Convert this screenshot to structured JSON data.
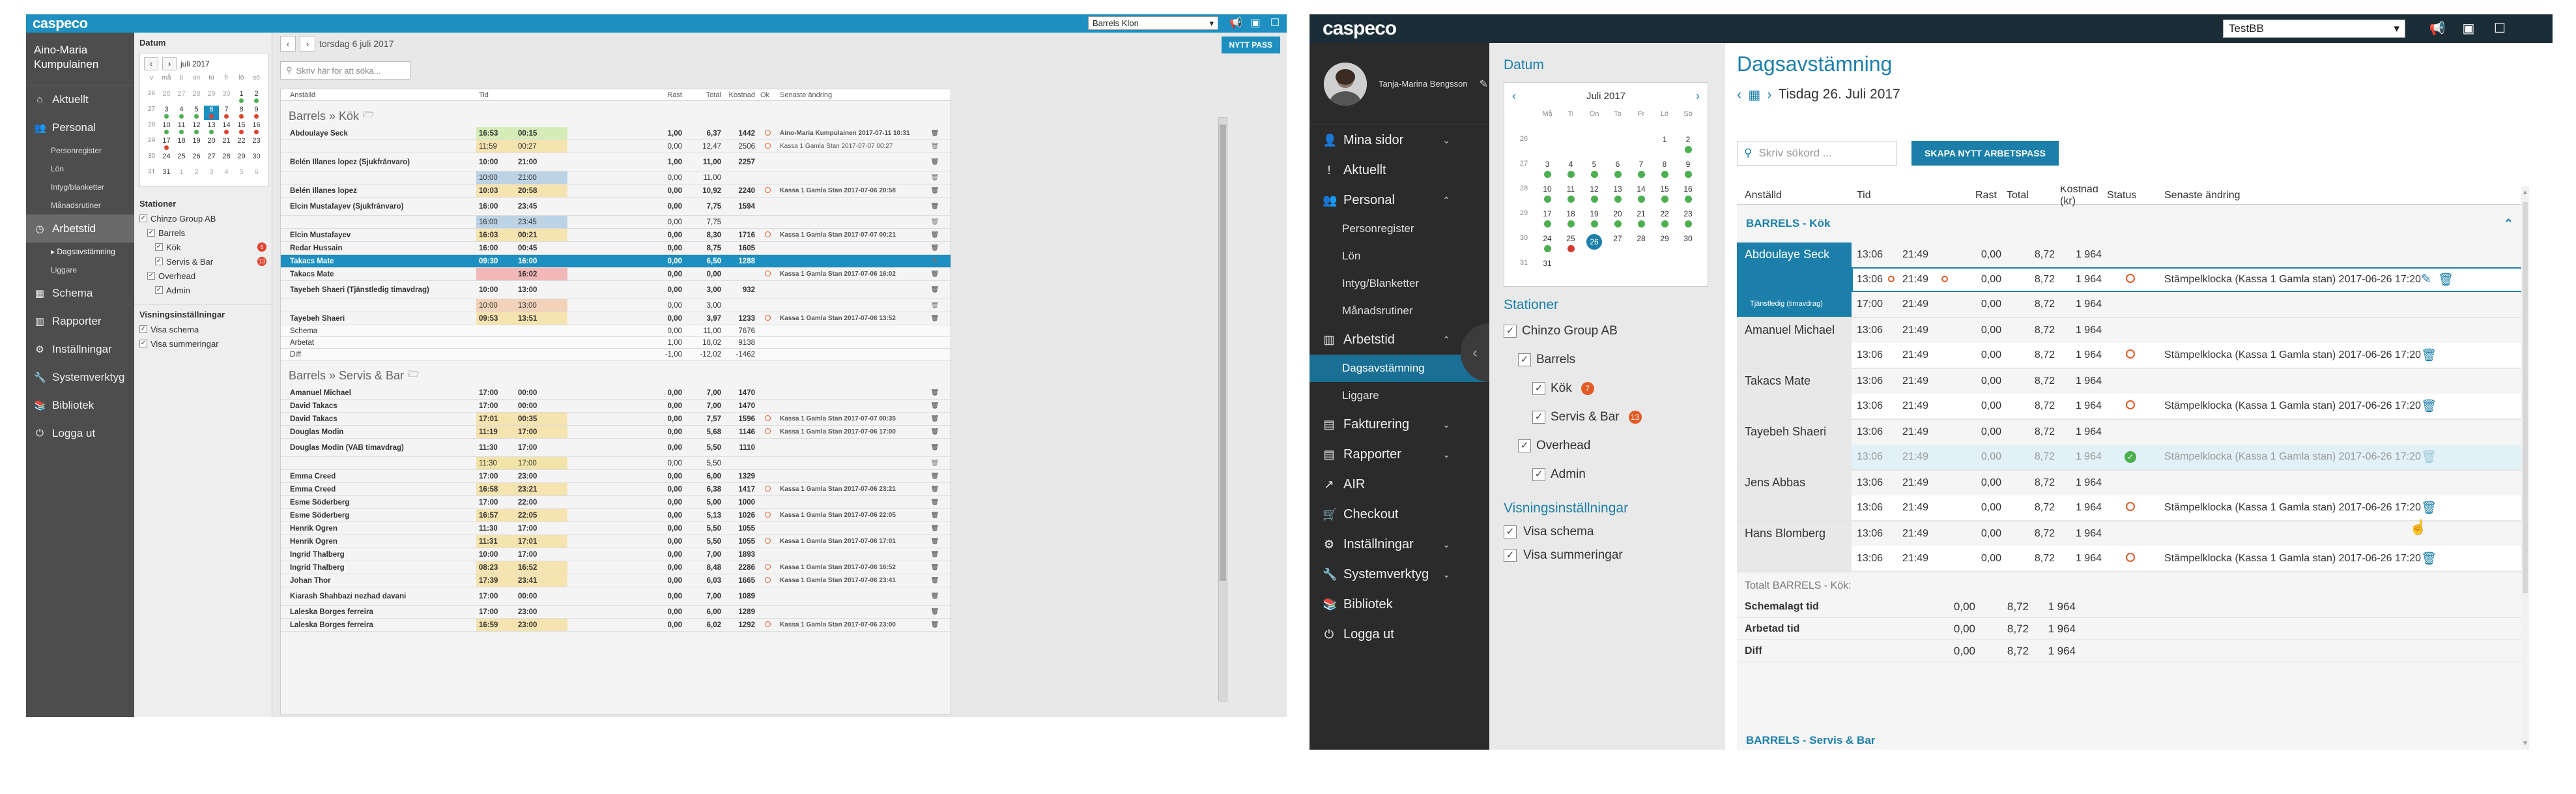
{
  "a": {
    "logo": "caspeco",
    "org_select": "Barrels Klon",
    "user_name": "Aino-Maria Kumpulainen",
    "nav": [
      {
        "label": "Aktuellt",
        "icon": "home-icon"
      },
      {
        "label": "Personal",
        "icon": "people-icon"
      },
      {
        "label": "Arbetstid",
        "icon": "clock-icon",
        "active": true
      },
      {
        "label": "Schema",
        "icon": "calendar-icon"
      },
      {
        "label": "Rapporter",
        "icon": "chart-icon"
      },
      {
        "label": "Inställningar",
        "icon": "gear-icon"
      },
      {
        "label": "Systemverktyg",
        "icon": "wrench-icon"
      },
      {
        "label": "Bibliotek",
        "icon": "book-icon"
      },
      {
        "label": "Logga ut",
        "icon": "power-icon"
      }
    ],
    "personal_subs": [
      "Personregister",
      "Lön",
      "Intyg/blanketter",
      "Månadsrutiner"
    ],
    "arbetstid_subs": [
      "Dagsavstämning",
      "Liggare"
    ],
    "datum_label": "Datum",
    "month_label": "juli 2017",
    "weekdays": [
      "v",
      "må",
      "ti",
      "on",
      "to",
      "fr",
      "lö",
      "sö"
    ],
    "calendar_rows": [
      [
        "26",
        "26",
        "27",
        "28",
        "29",
        "30",
        "1",
        "2"
      ],
      [
        "27",
        "3",
        "4",
        "5",
        "6",
        "7",
        "8",
        "9"
      ],
      [
        "28",
        "10",
        "11",
        "12",
        "13",
        "14",
        "15",
        "16"
      ],
      [
        "29",
        "17",
        "18",
        "19",
        "20",
        "21",
        "22",
        "23"
      ],
      [
        "30",
        "24",
        "25",
        "26",
        "27",
        "28",
        "29",
        "30"
      ],
      [
        "31",
        "31",
        "1",
        "2",
        "3",
        "4",
        "5",
        "6"
      ]
    ],
    "stationer_label": "Stationer",
    "tree": [
      {
        "label": "Chinzo Group AB",
        "indent": 0
      },
      {
        "label": "Barrels",
        "indent": 1
      },
      {
        "label": "Kök",
        "indent": 2,
        "badge": "6",
        "badge_color": "#e0412f"
      },
      {
        "label": "Servis & Bar",
        "indent": 2,
        "badge": "13",
        "badge_color": "#e0412f"
      },
      {
        "label": "Overhead",
        "indent": 1
      },
      {
        "label": "Admin",
        "indent": 2
      }
    ],
    "vis_label": "Visningsinställningar",
    "vis": [
      "Visa schema",
      "Visa summeringar"
    ],
    "date_text": "torsdag 6 juli 2017",
    "new_button": "NYTT PASS",
    "search_placeholder": "Skriv här för att söka...",
    "headers": [
      "Anställd",
      "Tid",
      "Rast",
      "Total",
      "Kostnad",
      "Ok",
      "Senaste ändring"
    ],
    "group1": "Barrels » Kök",
    "group2": "Barrels » Servis & Bar",
    "rows1": [
      {
        "name": "Abdoulaye Seck",
        "in": "16:53",
        "out": "00:15",
        "rast": "1,00",
        "tot": "6,37",
        "cost": "1442",
        "ok": "o",
        "chg": "Aino-Maria Kumpulainen 2017-07-11 10:31",
        "bg": "#d6ecb8"
      },
      {
        "name": "",
        "in": "11:59",
        "out": "00:27",
        "rast": "0,00",
        "tot": "12,47",
        "cost": "2506",
        "ok": "o",
        "chg": "Kassa 1 Gamla Stan 2017-07-07 00:27",
        "bg": "#f5e3b0"
      },
      {
        "name": "Belén Illanes lopez (Sjukfrånvaro)",
        "in": "10:00",
        "out": "21:00",
        "rast": "1,00",
        "tot": "11,00",
        "cost": "2257",
        "ok": "",
        "chg": "",
        "bg": "#f4f4f4"
      },
      {
        "name": "",
        "in": "10:00",
        "out": "21:00",
        "rast": "0,00",
        "tot": "11,00",
        "cost": "",
        "ok": "",
        "chg": "",
        "bg": "#bcd3e6"
      },
      {
        "name": "Belén Illanes lopez",
        "in": "10:03",
        "out": "20:58",
        "rast": "0,00",
        "tot": "10,92",
        "cost": "2240",
        "ok": "o",
        "chg": "Kassa 1 Gamla Stan 2017-07-06 20:58",
        "bg": "#f5e3b0"
      },
      {
        "name": "Elcin Mustafayev (Sjukfrånvaro)",
        "in": "16:00",
        "out": "23:45",
        "rast": "0,00",
        "tot": "7,75",
        "cost": "1594",
        "ok": "",
        "chg": "",
        "bg": "#f4f4f4"
      },
      {
        "name": "",
        "in": "16:00",
        "out": "23:45",
        "rast": "0,00",
        "tot": "7,75",
        "cost": "",
        "ok": "",
        "chg": "",
        "bg": "#bcd3e6"
      },
      {
        "name": "Elcin Mustafayev",
        "in": "16:03",
        "out": "00:21",
        "rast": "0,00",
        "tot": "8,30",
        "cost": "1716",
        "ok": "o",
        "chg": "Kassa 1 Gamla Stan 2017-07-07 00:21",
        "bg": "#f5e3b0"
      },
      {
        "name": "Redar Hussain",
        "in": "16:00",
        "out": "00:45",
        "rast": "0,00",
        "tot": "8,75",
        "cost": "1605",
        "ok": "",
        "chg": "",
        "bg": "#f4f4f4"
      },
      {
        "name": "Takacs Mate",
        "in": "09:30",
        "out": "16:00",
        "rast": "0,00",
        "tot": "6,50",
        "cost": "1288",
        "ok": "",
        "chg": "",
        "bg": "#1d8fc0",
        "sel": true
      },
      {
        "name": "Takacs Mate",
        "in": "",
        "out": "16:02",
        "rast": "0,00",
        "tot": "0,00",
        "cost": "",
        "ok": "o",
        "chg": "Kassa 1 Gamla Stan 2017-07-06 16:02",
        "bg": "#f2b8b8"
      },
      {
        "name": "Tayebeh Shaeri (Tjänstledig timavdrag)",
        "in": "10:00",
        "out": "13:00",
        "rast": "0,00",
        "tot": "3,00",
        "cost": "932",
        "ok": "",
        "chg": "",
        "bg": "#f4f4f4"
      },
      {
        "name": "",
        "in": "10:00",
        "out": "13:00",
        "rast": "0,00",
        "tot": "3,00",
        "cost": "",
        "ok": "",
        "chg": "",
        "bg": "#f2d2b8"
      },
      {
        "name": "Tayebeh Shaeri",
        "in": "09:53",
        "out": "13:51",
        "rast": "0,00",
        "tot": "3,97",
        "cost": "1233",
        "ok": "o",
        "chg": "Kassa 1 Gamla Stan 2017-07-06 13:52",
        "bg": "#f5e3b0"
      }
    ],
    "summary1": [
      {
        "label": "Schema",
        "rast": "0,00",
        "tot": "11,00",
        "cost": "7676"
      },
      {
        "label": "Arbetat",
        "rast": "1,00",
        "tot": "18,02",
        "cost": "9138"
      },
      {
        "label": "Diff",
        "rast": "-1,00",
        "tot": "-12,02",
        "cost": "-1462"
      }
    ],
    "rows2": [
      {
        "name": "Amanuel Michael",
        "in": "17:00",
        "out": "00:00",
        "rast": "0,00",
        "tot": "7,00",
        "cost": "1470",
        "ok": "",
        "chg": "",
        "bg": "#f4f4f4"
      },
      {
        "name": "David Takacs",
        "in": "17:00",
        "out": "00:00",
        "rast": "0,00",
        "tot": "7,00",
        "cost": "1470",
        "ok": "",
        "chg": "",
        "bg": "#f4f4f4"
      },
      {
        "name": "David Takacs",
        "in": "17:01",
        "out": "00:35",
        "rast": "0,00",
        "tot": "7,57",
        "cost": "1596",
        "ok": "o",
        "chg": "Kassa 1 Gamla Stan 2017-07-07 00:35",
        "bg": "#f5e3b0"
      },
      {
        "name": "Douglas Modin",
        "in": "11:19",
        "out": "17:00",
        "rast": "0,00",
        "tot": "5,68",
        "cost": "1146",
        "ok": "o",
        "chg": "Kassa 1 Gamla Stan 2017-07-06 17:00",
        "bg": "#f5e3b0"
      },
      {
        "name": "Douglas Modin (VAB timavdrag)",
        "in": "11:30",
        "out": "17:00",
        "rast": "0,00",
        "tot": "5,50",
        "cost": "1110",
        "ok": "",
        "chg": "",
        "bg": "#f4f4f4"
      },
      {
        "name": "",
        "in": "11:30",
        "out": "17:00",
        "rast": "0,00",
        "tot": "5,50",
        "cost": "",
        "ok": "",
        "chg": "",
        "bg": "#f2e4a8"
      },
      {
        "name": "Emma Creed",
        "in": "17:00",
        "out": "23:00",
        "rast": "0,00",
        "tot": "6,00",
        "cost": "1329",
        "ok": "",
        "chg": "",
        "bg": "#f4f4f4"
      },
      {
        "name": "Emma Creed",
        "in": "16:58",
        "out": "23:21",
        "rast": "0,00",
        "tot": "6,38",
        "cost": "1417",
        "ok": "o",
        "chg": "Kassa 1 Gamla Stan 2017-07-06 23:21",
        "bg": "#f5e3b0"
      },
      {
        "name": "Esme Söderberg",
        "in": "17:00",
        "out": "22:00",
        "rast": "0,00",
        "tot": "5,00",
        "cost": "1000",
        "ok": "",
        "chg": "",
        "bg": "#f4f4f4"
      },
      {
        "name": "Esme Söderberg",
        "in": "16:57",
        "out": "22:05",
        "rast": "0,00",
        "tot": "5,13",
        "cost": "1026",
        "ok": "o",
        "chg": "Kassa 1 Gamla Stan 2017-07-06 22:05",
        "bg": "#f5e3b0"
      },
      {
        "name": "Henrik Ögren",
        "in": "11:30",
        "out": "17:00",
        "rast": "0,00",
        "tot": "5,50",
        "cost": "1055",
        "ok": "",
        "chg": "",
        "bg": "#f4f4f4"
      },
      {
        "name": "Henrik Ögren",
        "in": "11:31",
        "out": "17:01",
        "rast": "0,00",
        "tot": "5,50",
        "cost": "1055",
        "ok": "o",
        "chg": "Kassa 1 Gamla Stan 2017-07-06 17:01",
        "bg": "#f5e3b0"
      },
      {
        "name": "Ingrid Thalberg",
        "in": "10:00",
        "out": "17:00",
        "rast": "0,00",
        "tot": "7,00",
        "cost": "1893",
        "ok": "",
        "chg": "",
        "bg": "#f4f4f4"
      },
      {
        "name": "Ingrid Thalberg",
        "in": "08:23",
        "out": "16:52",
        "rast": "0,00",
        "tot": "8,48",
        "cost": "2286",
        "ok": "o",
        "chg": "Kassa 1 Gamla Stan 2017-07-06 16:52",
        "bg": "#f5e3b0"
      },
      {
        "name": "Johan Thor",
        "in": "17:39",
        "out": "23:41",
        "rast": "0,00",
        "tot": "6,03",
        "cost": "1665",
        "ok": "o",
        "chg": "Kassa 1 Gamla Stan 2017-07-06 23:41",
        "bg": "#f5e3b0"
      },
      {
        "name": "Kiarash Shahbazi nezhad davani",
        "in": "17:00",
        "out": "00:00",
        "rast": "0,00",
        "tot": "7,00",
        "cost": "1089",
        "ok": "",
        "chg": "",
        "bg": "#f4f4f4"
      },
      {
        "name": "Laleska Borges ferreira",
        "in": "17:00",
        "out": "23:00",
        "rast": "0,00",
        "tot": "6,00",
        "cost": "1289",
        "ok": "",
        "chg": "",
        "bg": "#f4f4f4"
      },
      {
        "name": "Laleska Borges ferreira",
        "in": "16:59",
        "out": "23:00",
        "rast": "0,00",
        "tot": "6,02",
        "cost": "1292",
        "ok": "o",
        "chg": "Kassa 1 Gamla Stan 2017-07-06 23:00",
        "bg": "#f5e3b0"
      }
    ]
  },
  "b": {
    "logo": "caspeco",
    "org_select": "TestBB",
    "profile_name": "Tanja-Marina Bengsson",
    "nav": [
      {
        "label": "Mina sidor",
        "icon": "person-icon",
        "chev": "⌄"
      },
      {
        "label": "Aktuellt",
        "icon": "exclamation-icon",
        "chev": ""
      },
      {
        "label": "Personal",
        "icon": "people-icon",
        "chev": "⌃"
      }
    ],
    "personal_subs": [
      "Personregister",
      "Lön",
      "Intyg/Blanketter",
      "Månadsrutiner"
    ],
    "arbetstid": {
      "label": "Arbetstid",
      "icon": "chart-icon",
      "chev": "⌃"
    },
    "arbetstid_subs": [
      "Dagsavstämning",
      "Liggare"
    ],
    "nav2": [
      {
        "label": "Fakturering",
        "icon": "document-icon",
        "chev": "⌄"
      },
      {
        "label": "Rapporter",
        "icon": "document-icon",
        "chev": "⌄"
      },
      {
        "label": "AIR",
        "icon": "trend-icon",
        "chev": ""
      },
      {
        "label": "Checkout",
        "icon": "cart-icon",
        "chev": ""
      },
      {
        "label": "Inställningar",
        "icon": "gear-icon",
        "chev": "⌄"
      },
      {
        "label": "Systemverktyg",
        "icon": "wrench-icon",
        "chev": "⌄"
      },
      {
        "label": "Bibliotek",
        "icon": "book-icon",
        "chev": ""
      },
      {
        "label": "Logga ut",
        "icon": "power-icon",
        "chev": ""
      }
    ],
    "datum_label": "Datum",
    "month_label": "Juli 2017",
    "weekdays": [
      "",
      "Må",
      "Ti",
      "On",
      "To",
      "Fr",
      "Lö",
      "Sö"
    ],
    "calendar_rows": [
      [
        "26",
        "",
        "",
        "",
        "",
        "",
        "1",
        "2"
      ],
      [
        "27",
        "3",
        "4",
        "5",
        "6",
        "7",
        "8",
        "9"
      ],
      [
        "28",
        "10",
        "11",
        "12",
        "13",
        "14",
        "15",
        "16"
      ],
      [
        "29",
        "17",
        "18",
        "19",
        "20",
        "21",
        "22",
        "23"
      ],
      [
        "30",
        "24",
        "25",
        "26",
        "27",
        "28",
        "29",
        "30"
      ],
      [
        "31",
        "31",
        "",
        "",
        "",
        "",
        "",
        ""
      ]
    ],
    "stationer_label": "Stationer",
    "tree": [
      {
        "label": "Chinzo Group AB",
        "indent": 0
      },
      {
        "label": "Barrels",
        "indent": 1
      },
      {
        "label": "Kök",
        "indent": 2,
        "badge": "7",
        "badge_color": "#e35a23"
      },
      {
        "label": "Servis & Bar",
        "indent": 2,
        "badge": "13",
        "badge_color": "#e35a23"
      },
      {
        "label": "Overhead",
        "indent": 1
      },
      {
        "label": "Admin",
        "indent": 2
      }
    ],
    "vis_label": "Visningsinställningar",
    "vis": [
      "Visa schema",
      "Visa summeringar"
    ],
    "page_title": "Dagsavstämning",
    "date_text": "Tisdag 26. Juli 2017",
    "search_placeholder": "Skriv sökord ...",
    "new_button": "SKAPA NYTT ARBETSPASS",
    "headers": [
      "Anställd",
      "Tid",
      "Rast",
      "Total",
      "Kostnad (kr)",
      "Status",
      "Senaste ändring"
    ],
    "group1": "BARRELS - Kök",
    "group2": "BARRELS - Servis & Bar",
    "employees": [
      {
        "name": "Abdoulaye Seck",
        "sub": "Tjänstledig (timavdrag)",
        "sel": true,
        "lines": [
          {
            "in": "13:06",
            "out": "21:49",
            "rast": "0,00",
            "tot": "8,72",
            "cost": "1 964",
            "st": "",
            "chg": "",
            "o": false,
            "type": "plain"
          },
          {
            "in": "13:06",
            "out": "21:49",
            "rast": "0,00",
            "tot": "8,72",
            "cost": "1 964",
            "st": "o",
            "chg": "Stämpelklocka (Kassa 1 Gamla stan) 2017-06-26 17:20",
            "o": true,
            "type": "hl"
          },
          {
            "in": "17:00",
            "out": "21:49",
            "rast": "0,00",
            "tot": "8,72",
            "cost": "1 964",
            "st": "",
            "chg": "",
            "o": false,
            "type": "plain"
          }
        ]
      },
      {
        "name": "Amanuel Michael",
        "sub": "",
        "sel": false,
        "lines": [
          {
            "in": "13:06",
            "out": "21:49",
            "rast": "0,00",
            "tot": "8,72",
            "cost": "1 964",
            "st": "",
            "chg": "",
            "o": false,
            "type": "plain",
            "bubble": true
          },
          {
            "in": "13:06",
            "out": "21:49",
            "rast": "0,00",
            "tot": "8,72",
            "cost": "1 964",
            "st": "o",
            "chg": "Stämpelklocka (Kassa 1 Gamla stan) 2017-06-26 17:20",
            "o": false,
            "type": "wh"
          }
        ]
      },
      {
        "name": "Takacs Mate",
        "sub": "",
        "sel": false,
        "lines": [
          {
            "in": "13:06",
            "out": "21:49",
            "rast": "0,00",
            "tot": "8,72",
            "cost": "1 964",
            "st": "",
            "chg": "",
            "o": false,
            "type": "plain"
          },
          {
            "in": "13:06",
            "out": "21:49",
            "rast": "0,00",
            "tot": "8,72",
            "cost": "1 964",
            "st": "o",
            "chg": "Stämpelklocka (Kassa 1 Gamla stan) 2017-06-26 17:20",
            "o": false,
            "type": "wh"
          }
        ]
      },
      {
        "name": "Tayebeh Shaeri",
        "sub": "",
        "sel": false,
        "lines": [
          {
            "in": "13:06",
            "out": "21:49",
            "rast": "0,00",
            "tot": "8,72",
            "cost": "1 964",
            "st": "",
            "chg": "",
            "o": false,
            "type": "plain"
          },
          {
            "in": "13:06",
            "out": "21:49",
            "rast": "0,00",
            "tot": "8,72",
            "cost": "1 964",
            "st": "ok",
            "chg": "Stämpelklocka (Kassa 1 Gamla stan) 2017-06-26 17:20",
            "o": false,
            "type": "dim"
          }
        ]
      },
      {
        "name": "Jens Abbas",
        "sub": "",
        "sel": false,
        "lines": [
          {
            "in": "13:06",
            "out": "21:49",
            "rast": "0,00",
            "tot": "8,72",
            "cost": "1 964",
            "st": "",
            "chg": "",
            "o": false,
            "type": "plain"
          },
          {
            "in": "13:06",
            "out": "21:49",
            "rast": "0,00",
            "tot": "8,72",
            "cost": "1 964",
            "st": "o",
            "chg": "Stämpelklocka (Kassa 1 Gamla stan) 2017-06-26 17:20",
            "o": false,
            "type": "wh"
          }
        ]
      },
      {
        "name": "Hans Blomberg",
        "sub": "",
        "sel": false,
        "lines": [
          {
            "in": "13:06",
            "out": "21:49",
            "rast": "0,00",
            "tot": "8,72",
            "cost": "1 964",
            "st": "",
            "chg": "",
            "o": false,
            "type": "plain"
          },
          {
            "in": "13:06",
            "out": "21:49",
            "rast": "0,00",
            "tot": "8,72",
            "cost": "1 964",
            "st": "o",
            "chg": "Stämpelklocka (Kassa 1 Gamla stan) 2017-06-26 17:20",
            "o": false,
            "type": "wh"
          }
        ]
      }
    ],
    "summary_head": "Totalt BARRELS - Kök:",
    "summary": [
      {
        "label": "Schemalagt tid",
        "rast": "0,00",
        "tot": "8,72",
        "cost": "1 964"
      },
      {
        "label": "Arbetad tid",
        "rast": "0,00",
        "tot": "8,72",
        "cost": "1 964"
      },
      {
        "label": "Diff",
        "rast": "0,00",
        "tot": "8,72",
        "cost": "1 964"
      }
    ]
  }
}
